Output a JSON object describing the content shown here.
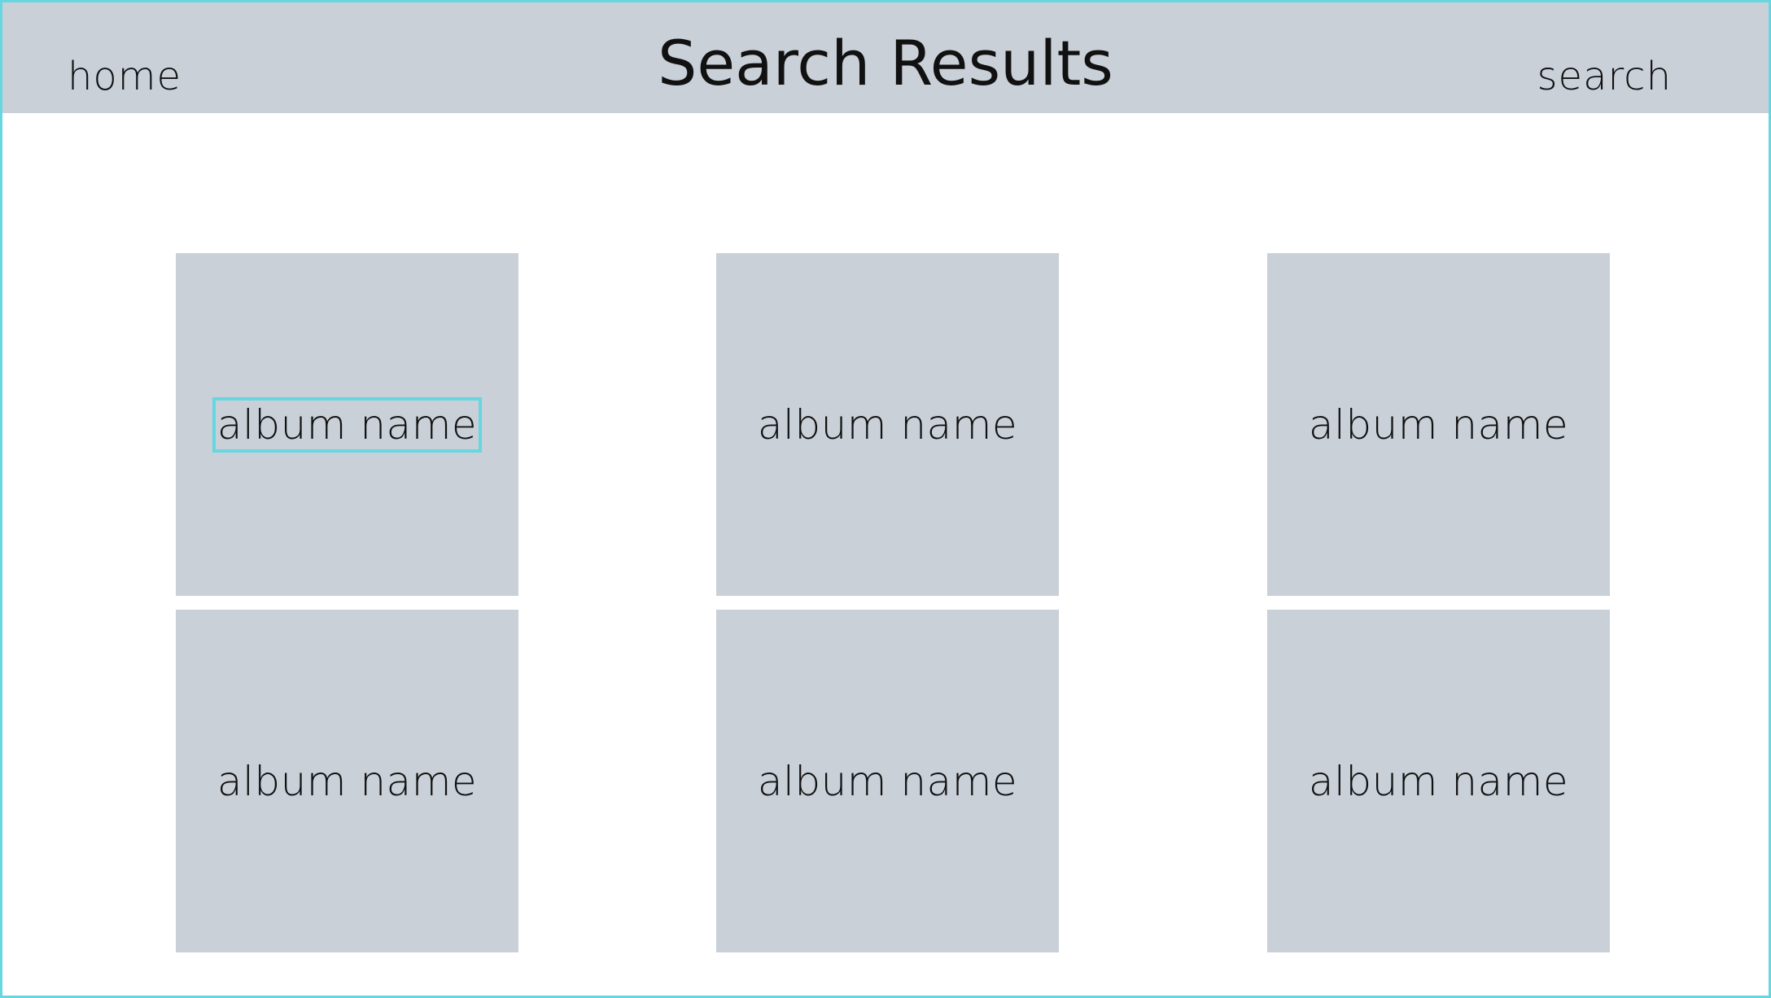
{
  "header": {
    "title": "Search Results",
    "home_label": "home",
    "search_label": "search"
  },
  "albums": [
    {
      "name": "album name",
      "selected": true
    },
    {
      "name": "album name",
      "selected": false
    },
    {
      "name": "album name",
      "selected": false
    },
    {
      "name": "album name",
      "selected": false
    },
    {
      "name": "album name",
      "selected": false
    },
    {
      "name": "album name",
      "selected": false
    }
  ],
  "colors": {
    "header_bg": "#c9d0d8",
    "card_bg": "#c9d0d8",
    "accent": "#66d6e0"
  }
}
